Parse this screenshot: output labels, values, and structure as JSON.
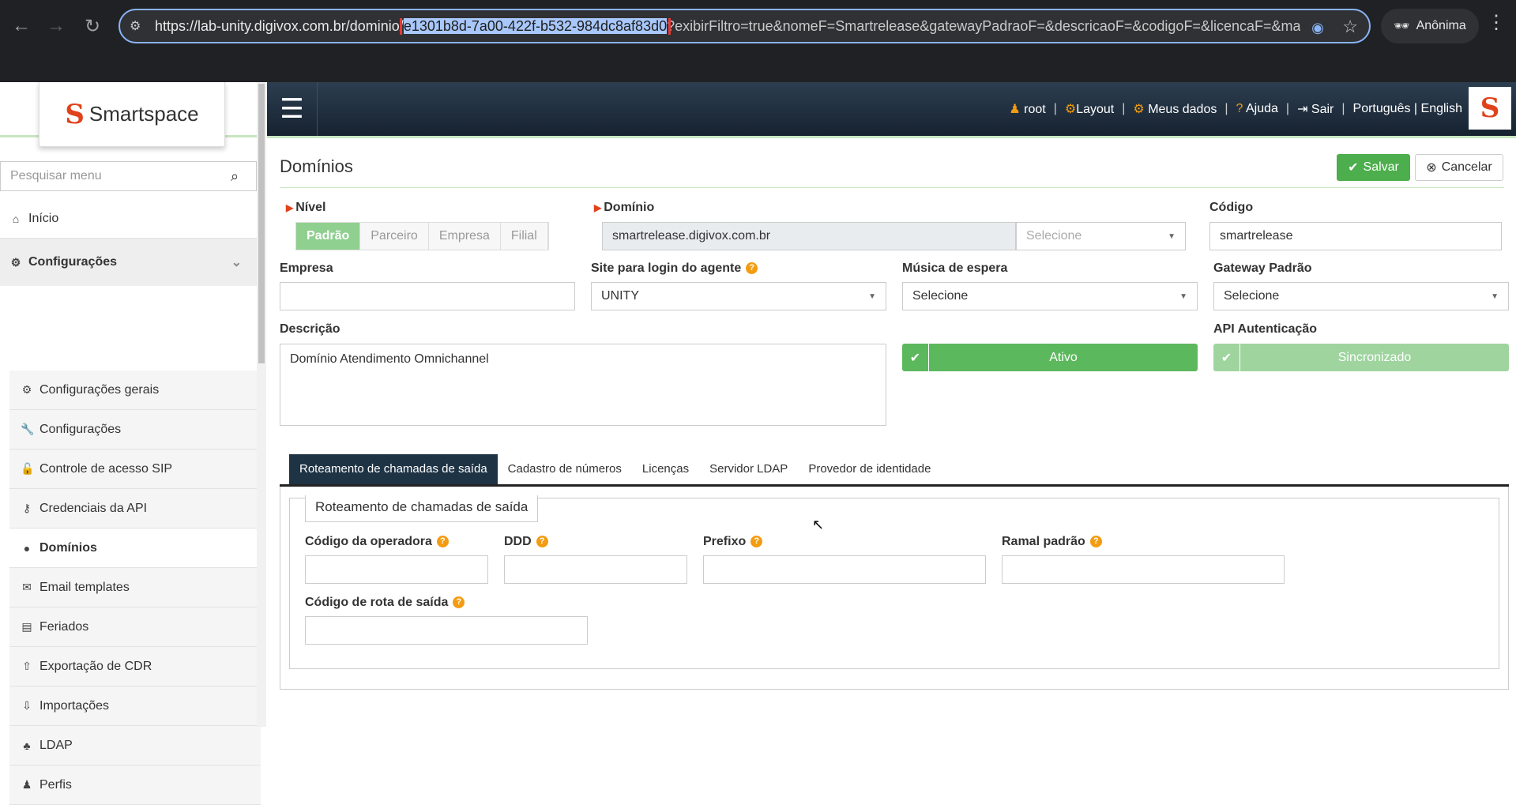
{
  "browser": {
    "url_prefix": "https://lab-unity.digivox.com.br/dominio/",
    "url_highlight": "e1301b8d-7a00-422f-b532-984dc8af83d0",
    "url_suffix": "?exibirFiltro=true&nomeF=Smartrelease&gatewayPadraoF=&descricaoF=&codigoF=&licencaF=&main",
    "profile_label": "Anônima"
  },
  "sidebar": {
    "logo_text": "Smartspace",
    "search_placeholder": "Pesquisar menu",
    "home": "Início",
    "group": "Configurações",
    "items": [
      {
        "label": "Configurações gerais",
        "icon": "gear-icon",
        "glyph": "⚙"
      },
      {
        "label": "Configurações",
        "icon": "wrench-icon",
        "glyph": "🔧"
      },
      {
        "label": "Controle de acesso SIP",
        "icon": "lock-icon",
        "glyph": "🔓"
      },
      {
        "label": "Credenciais da API",
        "icon": "key-icon",
        "glyph": "⚷"
      },
      {
        "label": "Domínios",
        "icon": "map-marker-icon",
        "glyph": "●"
      },
      {
        "label": "Email templates",
        "icon": "envelope-icon",
        "glyph": "✉"
      },
      {
        "label": "Feriados",
        "icon": "calendar-icon",
        "glyph": "▤"
      },
      {
        "label": "Exportação de CDR",
        "icon": "upload-icon",
        "glyph": "⇧"
      },
      {
        "label": "Importações",
        "icon": "download-icon",
        "glyph": "⇩"
      },
      {
        "label": "LDAP",
        "icon": "sitemap-icon",
        "glyph": "♣"
      },
      {
        "label": "Perfis",
        "icon": "user-icon",
        "glyph": "♟"
      }
    ]
  },
  "topbar": {
    "user": "root",
    "layout": "Layout",
    "my_data": "Meus dados",
    "help": "Ajuda",
    "logout": "Sair",
    "languages": "Português | English"
  },
  "page": {
    "title": "Domínios",
    "save": "Salvar",
    "cancel": "Cancelar"
  },
  "form": {
    "nivel_label": "Nível",
    "nivel_options": [
      "Padrão",
      "Parceiro",
      "Empresa",
      "Filial"
    ],
    "dominio_label": "Domínio",
    "dominio_value": "smartrelease.digivox.com.br",
    "dominio_select": "Selecione",
    "codigo_label": "Código",
    "codigo_value": "smartrelease",
    "empresa_label": "Empresa",
    "empresa_value": "",
    "site_label": "Site para login do agente",
    "site_value": "UNITY",
    "musica_label": "Música de espera",
    "musica_value": "Selecione",
    "gateway_label": "Gateway Padrão",
    "gateway_value": "Selecione",
    "descricao_label": "Descrição",
    "descricao_value": "Domínio Atendimento Omnichannel",
    "ativo_label": "Ativo",
    "api_label": "API Autenticação",
    "api_value": "Sincronizado"
  },
  "tabs": [
    "Roteamento de chamadas de saída",
    "Cadastro de números",
    "Licenças",
    "Servidor LDAP",
    "Provedor de identidade"
  ],
  "routing": {
    "legend": "Roteamento de chamadas de saída",
    "operadora": "Código da operadora",
    "ddd": "DDD",
    "prefixo": "Prefixo",
    "ramal": "Ramal padrão",
    "rota": "Código de rota de saída"
  }
}
